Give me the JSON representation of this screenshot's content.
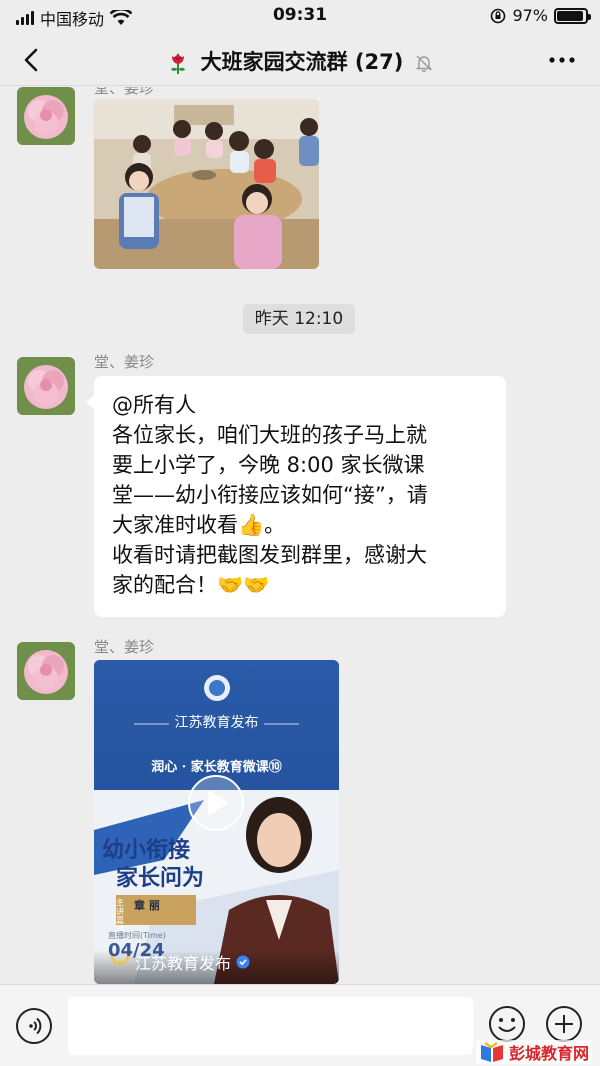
{
  "status_bar": {
    "carrier": "中国移动",
    "time": "09:31",
    "battery": "97%",
    "battery_level": 0.97
  },
  "header": {
    "title": "大班家园交流群 (27)",
    "title_emoji_icon": "rose-icon",
    "muted_icon": "bell-slash-icon"
  },
  "messages": {
    "sender_top_partial": "堂、姜珍",
    "timestamp": "昨天 12:10",
    "text_message": {
      "sender": "堂、姜珍",
      "lines": [
        "@所有人",
        "各位家长，咱们大班的孩子马上就",
        "要上小学了，今晚 8:00 家长微课",
        "堂——幼小衔接应该如何“接”，请",
        "大家准时收看👍。",
        "收看时请把截图发到群里，感谢大",
        "家的配合！🤝🤝"
      ]
    },
    "video_message": {
      "sender": "堂、姜珍",
      "brand": "江苏教育发布",
      "series": "润心 · 家长教育微课⑩",
      "headline_1": "幼小衔接",
      "headline_2": "家长问为",
      "speaker_name": "章 丽",
      "tag": "主讲嘉宾",
      "broadcast_label": "直播时间(Time)",
      "date": "04/24",
      "channel": "江苏教育发布"
    }
  },
  "input": {
    "placeholder": ""
  },
  "watermark": {
    "text": "彭城教育网"
  },
  "colors": {
    "background": "#ededed",
    "bubble": "#ffffff",
    "card_blue": "#2b5aa6",
    "watermark_red": "#d8262c"
  }
}
